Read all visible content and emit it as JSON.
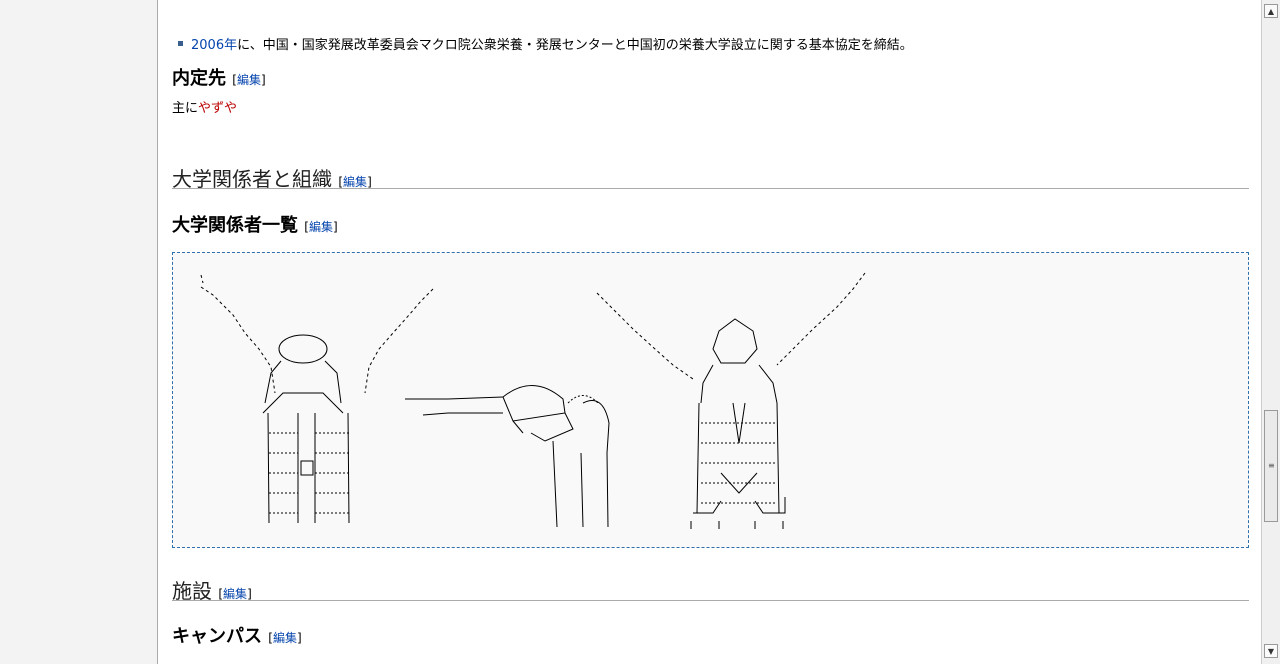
{
  "bullet": {
    "year_link": "2006年",
    "text": "に、中国・国家発展改革委員会マクロ院公衆栄養・発展センターと中国初の栄養大学設立に関する基本協定を締結。"
  },
  "sections": {
    "naiteisaki": {
      "title": "内定先",
      "edit": "編集"
    },
    "naiteisaki_body": {
      "prefix": "主に",
      "link": "やずや"
    },
    "kankeisha": {
      "title": "大学関係者と組織",
      "edit": "編集"
    },
    "kankeisha_list": {
      "title": "大学関係者一覧",
      "edit": "編集"
    },
    "shisetsu": {
      "title": "施設",
      "edit": "編集"
    },
    "campus": {
      "title": "キャンパス",
      "edit": "編集"
    }
  },
  "scrollbar": {
    "up": "▲",
    "down": "▼",
    "grip": "≡"
  }
}
